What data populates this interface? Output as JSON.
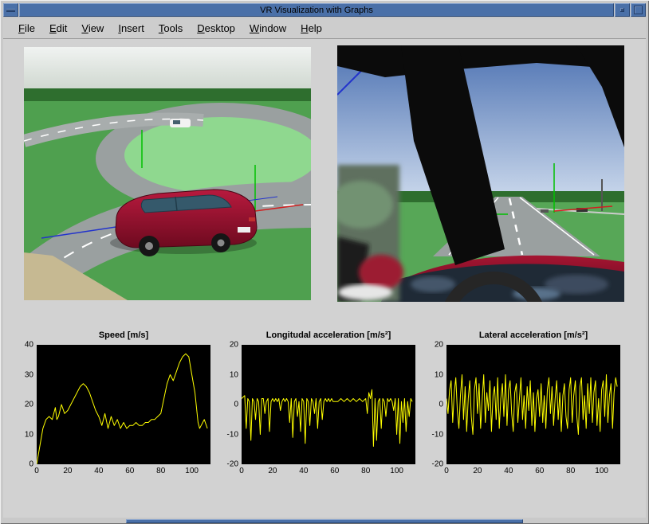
{
  "window": {
    "title": "VR Visualization with Graphs"
  },
  "colors": {
    "titlebar": "#4a70a8",
    "figure_bg": "#d2d2d2",
    "plot_bg": "#000000",
    "line": "#ffff00"
  },
  "menu": {
    "items": [
      "File",
      "Edit",
      "View",
      "Insert",
      "Tools",
      "Desktop",
      "Window",
      "Help"
    ]
  },
  "chart_data": [
    {
      "type": "line",
      "title": "Speed [m/s]",
      "xlim": [
        0,
        112
      ],
      "ylim": [
        0,
        40
      ],
      "xticks": [
        0,
        20,
        40,
        60,
        80,
        100
      ],
      "yticks": [
        0,
        10,
        20,
        30,
        40
      ],
      "line_color": "#ffff00",
      "x": [
        0,
        2,
        4,
        6,
        8,
        10,
        12,
        13,
        14,
        16,
        18,
        20,
        22,
        24,
        26,
        28,
        30,
        32,
        34,
        36,
        38,
        40,
        42,
        44,
        46,
        48,
        50,
        52,
        54,
        56,
        58,
        60,
        62,
        64,
        66,
        68,
        70,
        72,
        74,
        76,
        78,
        80,
        82,
        84,
        86,
        88,
        90,
        92,
        94,
        96,
        98,
        100,
        102,
        104,
        105,
        106,
        108,
        110
      ],
      "y": [
        0,
        6,
        12,
        15,
        16,
        15,
        19,
        15,
        16,
        20,
        17,
        18,
        20,
        22,
        24,
        26,
        27,
        26,
        24,
        21,
        18,
        16,
        13,
        17,
        12,
        16,
        13,
        15,
        12,
        14,
        12,
        13,
        13,
        14,
        13,
        13,
        14,
        14,
        15,
        15,
        16,
        17,
        22,
        27,
        30,
        28,
        31,
        34,
        36,
        37,
        36,
        30,
        24,
        14,
        12,
        13,
        15,
        12
      ]
    },
    {
      "type": "line",
      "title": "Longitudal acceleration [m/s²]",
      "xlim": [
        0,
        112
      ],
      "ylim": [
        -20,
        20
      ],
      "xticks": [
        0,
        20,
        40,
        60,
        80,
        100
      ],
      "yticks": [
        -20,
        -10,
        0,
        10,
        20
      ],
      "line_color": "#ffff00",
      "x": [
        0,
        2,
        3,
        4,
        5,
        6,
        7,
        8,
        9,
        10,
        11,
        12,
        13,
        14,
        15,
        16,
        17,
        18,
        19,
        20,
        21,
        22,
        23,
        24,
        25,
        26,
        27,
        28,
        29,
        30,
        31,
        32,
        33,
        34,
        35,
        36,
        37,
        38,
        39,
        40,
        41,
        42,
        43,
        44,
        45,
        46,
        47,
        48,
        49,
        50,
        51,
        52,
        53,
        54,
        55,
        56,
        57,
        58,
        59,
        60,
        62,
        64,
        66,
        68,
        70,
        72,
        74,
        76,
        78,
        80,
        81,
        82,
        83,
        84,
        85,
        86,
        87,
        88,
        89,
        90,
        91,
        92,
        93,
        94,
        95,
        96,
        97,
        98,
        99,
        100,
        101,
        102,
        103,
        104,
        105,
        106,
        107,
        108,
        109,
        110
      ],
      "y": [
        2,
        3,
        -8,
        2,
        1,
        -12,
        2,
        1,
        -5,
        2,
        1,
        -10,
        2,
        2,
        -3,
        1,
        2,
        -9,
        1,
        2,
        1,
        2,
        1,
        2,
        -2,
        1,
        2,
        1,
        2,
        1,
        -6,
        2,
        -11,
        1,
        2,
        -4,
        1,
        -9,
        2,
        1,
        -13,
        2,
        1,
        -7,
        2,
        1,
        -3,
        2,
        -8,
        1,
        2,
        -5,
        1,
        2,
        1,
        2,
        1,
        2,
        1,
        1,
        1,
        2,
        1,
        2,
        1,
        2,
        1,
        2,
        1,
        2,
        -3,
        4,
        2,
        5,
        -14,
        2,
        -12,
        1,
        2,
        -8,
        2,
        1,
        -4,
        2,
        1,
        2,
        1,
        -2,
        2,
        -10,
        2,
        -13,
        1,
        -6,
        2,
        -9,
        1,
        -4,
        2,
        1
      ]
    },
    {
      "type": "line",
      "title": "Lateral acceleration [m/s²]",
      "xlim": [
        0,
        112
      ],
      "ylim": [
        -20,
        20
      ],
      "xticks": [
        0,
        20,
        40,
        60,
        80,
        100
      ],
      "yticks": [
        -20,
        -10,
        0,
        10,
        20
      ],
      "line_color": "#ffff00",
      "x": [
        0,
        1,
        2,
        3,
        4,
        5,
        6,
        7,
        8,
        9,
        10,
        11,
        12,
        13,
        14,
        15,
        16,
        17,
        18,
        19,
        20,
        21,
        22,
        23,
        24,
        25,
        26,
        27,
        28,
        29,
        30,
        31,
        32,
        33,
        34,
        35,
        36,
        37,
        38,
        39,
        40,
        41,
        42,
        43,
        44,
        45,
        46,
        47,
        48,
        49,
        50,
        51,
        52,
        53,
        54,
        55,
        56,
        57,
        58,
        59,
        60,
        61,
        62,
        63,
        64,
        65,
        66,
        67,
        68,
        69,
        70,
        71,
        72,
        73,
        74,
        75,
        76,
        77,
        78,
        79,
        80,
        81,
        82,
        83,
        84,
        85,
        86,
        87,
        88,
        89,
        90,
        91,
        92,
        93,
        94,
        95,
        96,
        97,
        98,
        99,
        100,
        101,
        102,
        103,
        104,
        105,
        106,
        107,
        108,
        109,
        110
      ],
      "y": [
        2,
        -3,
        5,
        8,
        -6,
        4,
        9,
        -2,
        -8,
        3,
        10,
        -5,
        6,
        -9,
        2,
        8,
        -4,
        -10,
        5,
        9,
        -3,
        7,
        -8,
        2,
        10,
        -6,
        4,
        -2,
        8,
        -9,
        3,
        6,
        -5,
        9,
        -8,
        2,
        7,
        -4,
        10,
        -7,
        5,
        8,
        -3,
        -9,
        4,
        7,
        -6,
        2,
        9,
        -5,
        3,
        -8,
        6,
        -2,
        8,
        -7,
        4,
        -9,
        2,
        5,
        -4,
        7,
        -6,
        3,
        -8,
        5,
        9,
        -3,
        6,
        -7,
        2,
        8,
        -5,
        4,
        -9,
        3,
        7,
        -4,
        -8,
        5,
        9,
        -6,
        3,
        8,
        -4,
        -10,
        6,
        9,
        -5,
        3,
        -8,
        7,
        -3,
        9,
        -6,
        4,
        8,
        -7,
        2,
        -9,
        5,
        8,
        -4,
        10,
        -6,
        3,
        7,
        -8,
        4,
        9,
        6
      ]
    }
  ]
}
